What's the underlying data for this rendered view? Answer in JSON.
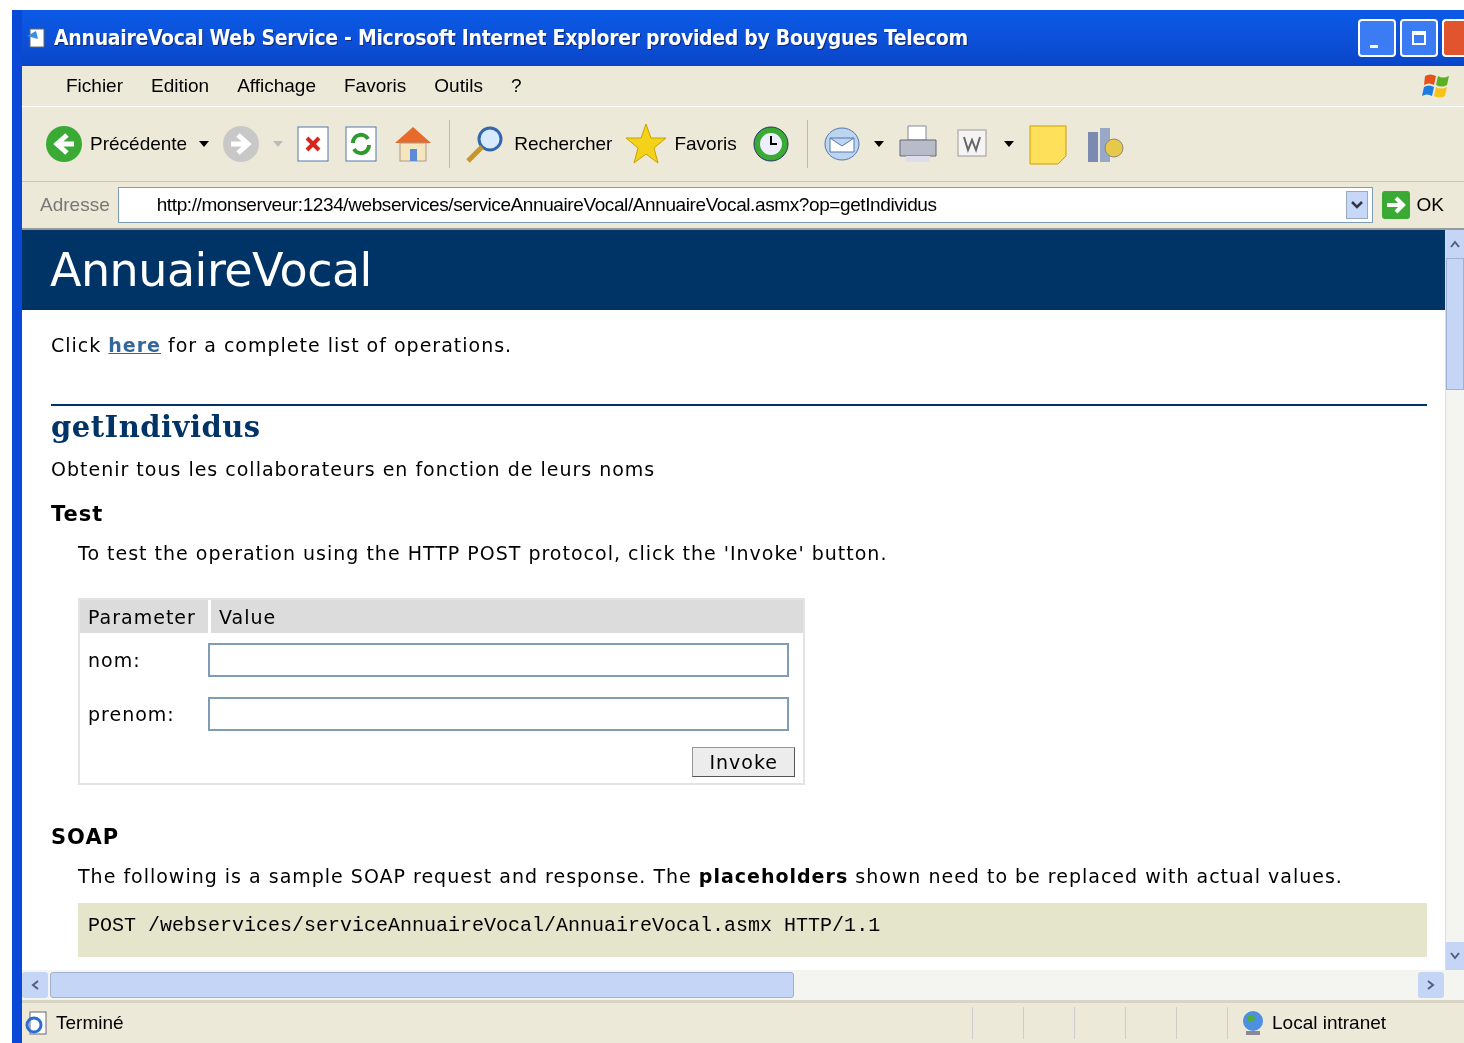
{
  "window": {
    "title": "AnnuaireVocal Web Service - Microsoft Internet Explorer provided by Bouygues Telecom"
  },
  "menu": [
    "Fichier",
    "Edition",
    "Affichage",
    "Favoris",
    "Outils",
    "?"
  ],
  "toolbar": {
    "back_label": "Précédente",
    "forward": {
      "disabled": true
    },
    "search_label": "Rechercher",
    "favorites_label": "Favoris"
  },
  "address_bar": {
    "label": "Adresse",
    "value": "http://monserveur:1234/webservices/serviceAnnuaireVocal/AnnuaireVocal.asmx?op=getIndividus",
    "go_label": "OK"
  },
  "page": {
    "banner": "AnnuaireVocal",
    "intro": {
      "before": "Click",
      "link": "here",
      "after": "for a complete list of operations."
    },
    "operation": "getIndividus",
    "description": "Obtenir tous les collaborateurs en fonction de leurs noms",
    "test": {
      "heading": "Test",
      "text": "To test the operation using the HTTP POST protocol, click the 'Invoke' button.",
      "columns": [
        "Parameter",
        "Value"
      ],
      "params": [
        {
          "name": "nom:"
        },
        {
          "name": "prenom:"
        }
      ],
      "button": "Invoke"
    },
    "soap": {
      "heading": "SOAP",
      "text": "The following is a sample SOAP request and response. The **placeholders** shown need to be replaced with actual values.",
      "code": "POST /webservices/serviceAnnuaireVocal/AnnuaireVocal.asmx HTTP/1.1"
    }
  },
  "status_bar": {
    "text": "Terminé",
    "zone": "Local intranet"
  }
}
